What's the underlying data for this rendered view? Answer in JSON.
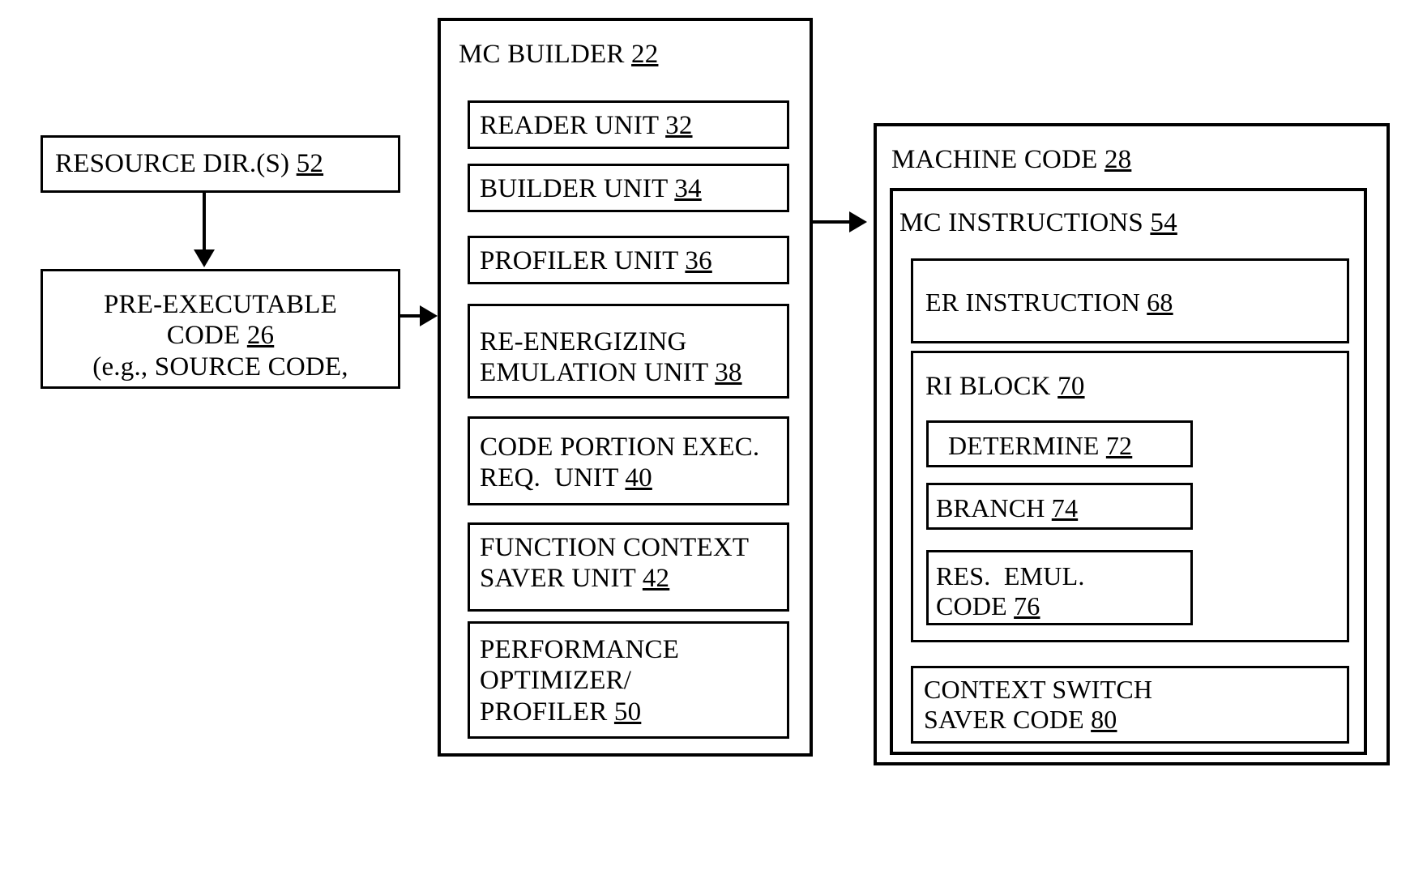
{
  "diagram": {
    "title": "MC Builder machine code generation block diagram",
    "stroke_color": "#000000",
    "background_color": "#ffffff"
  },
  "left_column": {
    "resource_dir": {
      "label": "RESOURCE DIR.(S)",
      "ref": "52"
    },
    "pre_executable": {
      "line1": "PRE-EXECUTABLE",
      "line2_label": "CODE",
      "line2_ref": "26",
      "line3": "(e.g., SOURCE CODE,"
    }
  },
  "mc_builder": {
    "title_label": "MC BUILDER",
    "title_ref": "22",
    "units": [
      {
        "lines": [
          "READER UNIT"
        ],
        "ref": "32",
        "ref_line": 0
      },
      {
        "lines": [
          "BUILDER UNIT"
        ],
        "ref": "34",
        "ref_line": 0
      },
      {
        "lines": [
          "PROFILER UNIT"
        ],
        "ref": "36",
        "ref_line": 0
      },
      {
        "lines": [
          "RE-ENERGIZING",
          "EMULATION UNIT "
        ],
        "ref": "38",
        "ref_line": 1
      },
      {
        "lines": [
          "CODE PORTION EXEC.",
          "REQ.  UNIT "
        ],
        "ref": "40",
        "ref_line": 1
      },
      {
        "lines": [
          "FUNCTION CONTEXT",
          "SAVER UNIT "
        ],
        "ref": "42",
        "ref_line": 1
      },
      {
        "lines": [
          "PERFORMANCE",
          "OPTIMIZER/",
          "PROFILER "
        ],
        "ref": "50",
        "ref_line": 2
      }
    ]
  },
  "machine_code": {
    "title_label": "MACHINE CODE",
    "title_ref": "28",
    "mc_instructions": {
      "title_label": "MC INSTRUCTIONS",
      "title_ref": "54",
      "er_instruction": {
        "label": "ER INSTRUCTION",
        "ref": "68"
      },
      "ri_block": {
        "title_label": "RI BLOCK",
        "title_ref": "70",
        "items": [
          {
            "lines": [
              "DETERMINE "
            ],
            "ref": "72",
            "ref_line": 0
          },
          {
            "lines": [
              "BRANCH "
            ],
            "ref": "74",
            "ref_line": 0
          },
          {
            "lines": [
              "RES.  EMUL.",
              "CODE "
            ],
            "ref": "76",
            "ref_line": 1
          }
        ]
      },
      "context_switch": {
        "lines": [
          "CONTEXT SWITCH",
          "SAVER CODE "
        ],
        "ref": "80",
        "ref_line": 1
      }
    }
  },
  "connectors": [
    {
      "name": "resource-dir-to-pre-executable",
      "direction": "down"
    },
    {
      "name": "pre-executable-to-mc-builder",
      "direction": "right"
    },
    {
      "name": "mc-builder-to-machine-code",
      "direction": "right"
    }
  ]
}
